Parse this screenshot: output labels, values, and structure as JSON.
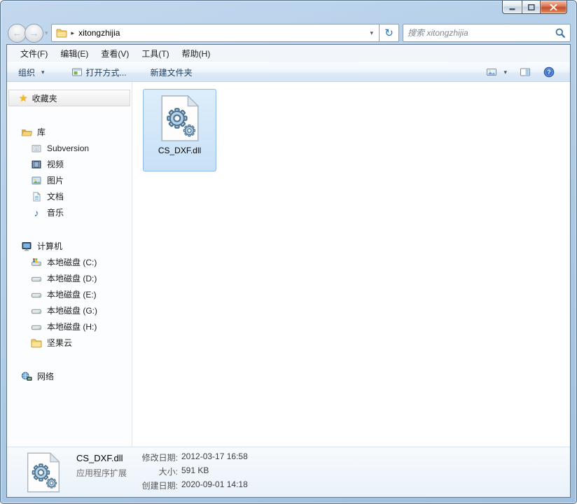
{
  "address": {
    "breadcrumb": "xitongzhijia",
    "search_placeholder": "搜索 xitongzhijia"
  },
  "icons": {
    "back": "←",
    "forward": "→",
    "nav_dropdown": "▾",
    "breadcrumb_arrow": "▸",
    "address_dropdown": "▾",
    "refresh": "↻",
    "organize_dropdown": "▾",
    "views_dropdown": "▾",
    "star": "★",
    "music_note": "♪"
  },
  "menu_bar": {
    "items": [
      "文件(F)",
      "编辑(E)",
      "查看(V)",
      "工具(T)",
      "帮助(H)"
    ]
  },
  "toolbar": {
    "organize": "组织",
    "open_with": "打开方式...",
    "new_folder": "新建文件夹"
  },
  "sidebar": {
    "favorites": {
      "label": "收藏夹"
    },
    "libraries": {
      "label": "库",
      "children": [
        {
          "label": "Subversion"
        },
        {
          "label": "视频"
        },
        {
          "label": "图片"
        },
        {
          "label": "文档"
        },
        {
          "label": "音乐"
        }
      ]
    },
    "computer": {
      "label": "计算机",
      "children": [
        {
          "label": "本地磁盘 (C:)"
        },
        {
          "label": "本地磁盘 (D:)"
        },
        {
          "label": "本地磁盘 (E:)"
        },
        {
          "label": "本地磁盘 (G:)"
        },
        {
          "label": "本地磁盘 (H:)"
        },
        {
          "label": "坚果云"
        }
      ]
    },
    "network": {
      "label": "网络"
    }
  },
  "main": {
    "file": {
      "name": "CS_DXF.dll",
      "selected": true
    }
  },
  "details": {
    "name": "CS_DXF.dll",
    "type": "应用程序扩展",
    "modified_label": "修改日期:",
    "modified": "2012-03-17 16:58",
    "size_label": "大小:",
    "size": "591 KB",
    "created_label": "创建日期:",
    "created": "2020-09-01 14:18"
  },
  "colors": {
    "frame": "#b3cfe8",
    "selection_fill": "#d3e7f8",
    "selection_border": "#8fbbe4",
    "toolbar_text": "#1e3c5a",
    "close_button": "#c2512e",
    "accent_blue": "#3a6ea5",
    "star_gold": "#f5b916"
  }
}
